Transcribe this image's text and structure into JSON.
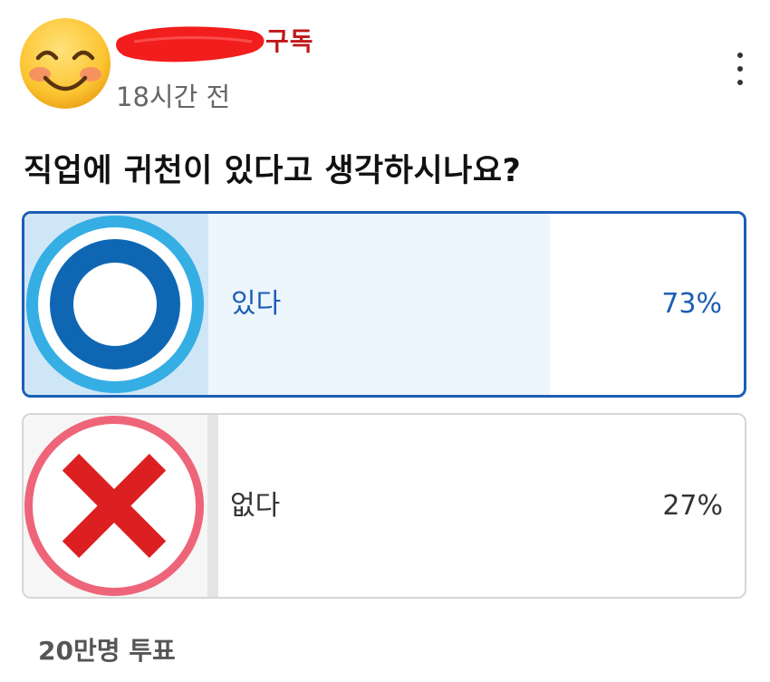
{
  "post": {
    "author_action": "구독",
    "timestamp": "18시간 전",
    "avatar_icon": "smiling-face-emoji",
    "menu_icon": "more-vertical-icon"
  },
  "poll": {
    "question": "직업에 귀천이 있다고 생각하시나요?",
    "options": [
      {
        "label": "있다",
        "percent_text": "73%",
        "percent": 73,
        "selected": true,
        "icon": "circle-o-icon"
      },
      {
        "label": "없다",
        "percent_text": "27%",
        "percent": 27,
        "selected": false,
        "icon": "x-mark-icon"
      }
    ],
    "vote_count": "20만명 투표"
  },
  "colors": {
    "accent": "#1c5eb4",
    "subscribe": "#c0171a",
    "selected_fill": "#edf5fd",
    "unselected_fill": "#e5e5e5",
    "redaction": "#f21d1d"
  }
}
